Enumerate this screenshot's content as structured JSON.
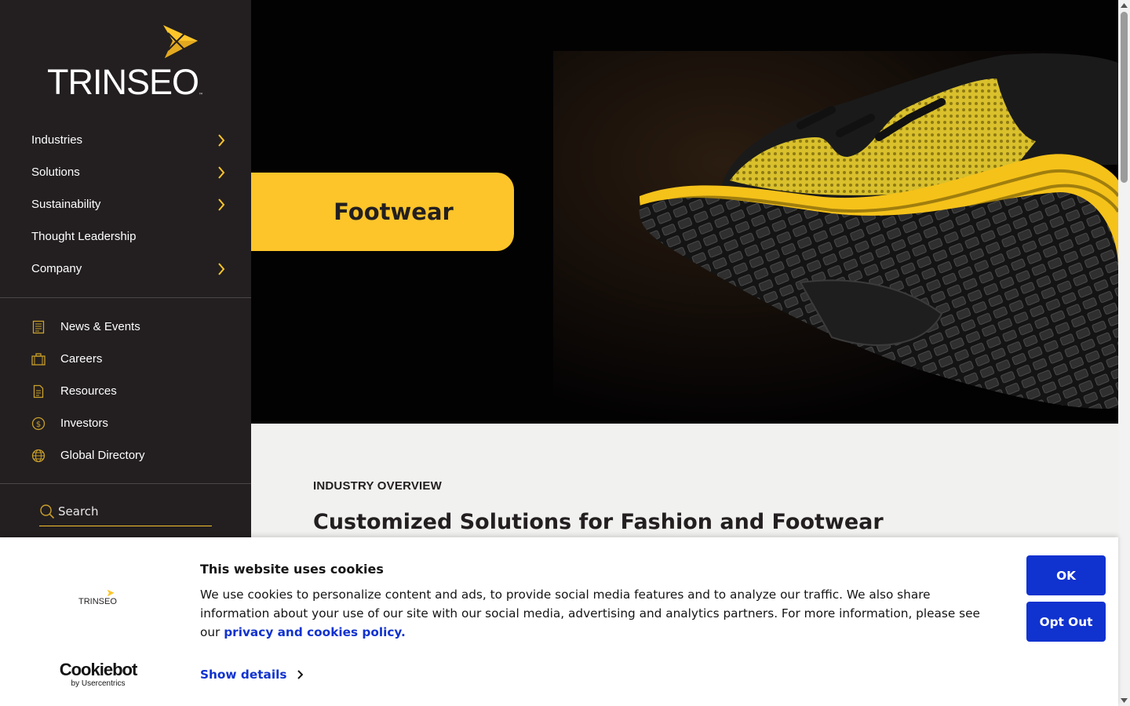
{
  "brand": {
    "name": "TRINSEO",
    "trademark": "™",
    "accent": "#fdc52a",
    "sidebar_bg": "#231f20"
  },
  "sidebar": {
    "main_nav": [
      {
        "label": "Industries",
        "has_submenu": true
      },
      {
        "label": "Solutions",
        "has_submenu": true
      },
      {
        "label": "Sustainability",
        "has_submenu": true
      },
      {
        "label": "Thought Leadership",
        "has_submenu": false
      },
      {
        "label": "Company",
        "has_submenu": true
      }
    ],
    "secondary_nav": [
      {
        "label": "News & Events",
        "icon": "newspaper-icon"
      },
      {
        "label": "Careers",
        "icon": "briefcase-icon"
      },
      {
        "label": "Resources",
        "icon": "document-icon"
      },
      {
        "label": "Investors",
        "icon": "dollar-coin-icon"
      },
      {
        "label": "Global Directory",
        "icon": "globe-icon"
      }
    ],
    "search": {
      "placeholder": "Search",
      "icon": "search-icon"
    }
  },
  "hero": {
    "tag": "Footwear",
    "image": "shoe-sole-image"
  },
  "overview": {
    "eyebrow": "INDUSTRY OVERVIEW",
    "title": "Customized Solutions for Fashion and Footwear"
  },
  "cookie_banner": {
    "logo_text": "TRINSEO",
    "title": "This website uses cookies",
    "body": "We use cookies to personalize content and ads, to provide social media features and to analyze our traffic. We also share information about your use of our site with our social media, advertising and analytics partners. For more information, please see our ",
    "policy_link": "privacy and cookies policy.",
    "details_label": "Show details",
    "ok_label": "OK",
    "opt_out_label": "Opt Out",
    "provider_name": "Cookiebot",
    "provider_sub": "by Usercentrics",
    "button_color": "#1032cf"
  }
}
